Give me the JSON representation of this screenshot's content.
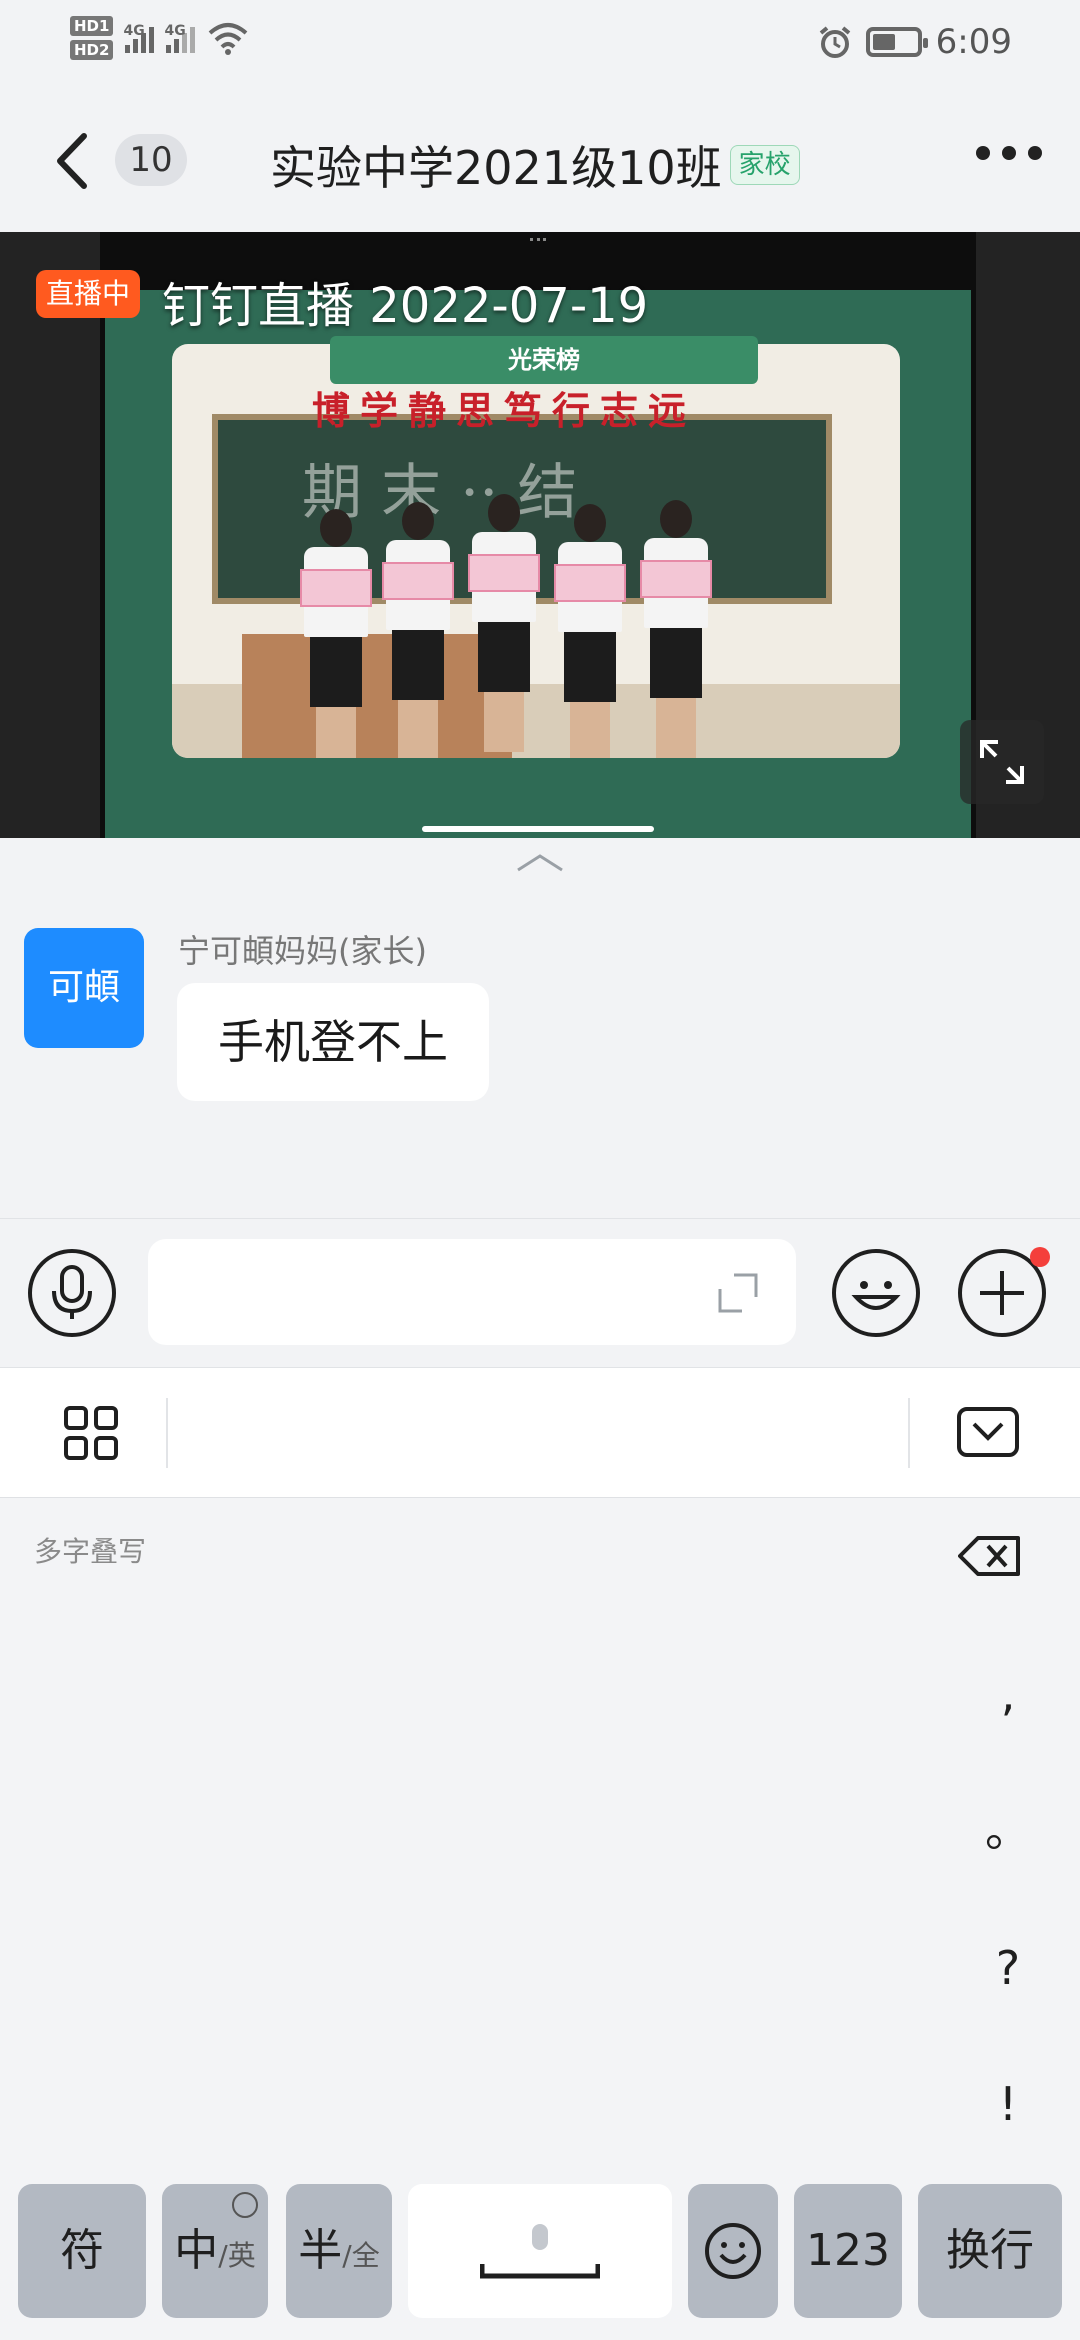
{
  "status_bar": {
    "hd1": "HD1",
    "hd2": "HD2",
    "net1": "4G",
    "net2": "4G",
    "time": "6:09"
  },
  "nav": {
    "unread_count": "10",
    "title": "实验中学2021级10班",
    "tag": "家校"
  },
  "live": {
    "badge": "直播中",
    "title": "钉钉直播 2022-07-19",
    "banner": "光荣榜",
    "motto": "博学静思笃行志远",
    "board_text": "期 末 ·· 结"
  },
  "message": {
    "avatar_text": "可頔",
    "sender": "宁可頔妈妈(家长)",
    "content": "手机登不上"
  },
  "input": {
    "value": "",
    "placeholder": ""
  },
  "keyboard": {
    "handwriting_label": "多字叠写",
    "side_keys": [
      ",",
      "。",
      "?",
      "!"
    ],
    "keys": {
      "symbol": "符",
      "lang_main": "中",
      "lang_sub": "/英",
      "width_main": "半",
      "width_sub": "/全",
      "emoji": "☺",
      "numbers": "123",
      "enter": "换行"
    }
  },
  "colors": {
    "accent_blue": "#1e8cff",
    "live_orange": "#ff5a1f",
    "tag_green": "#26a26b",
    "red_dot": "#f43f3b"
  }
}
